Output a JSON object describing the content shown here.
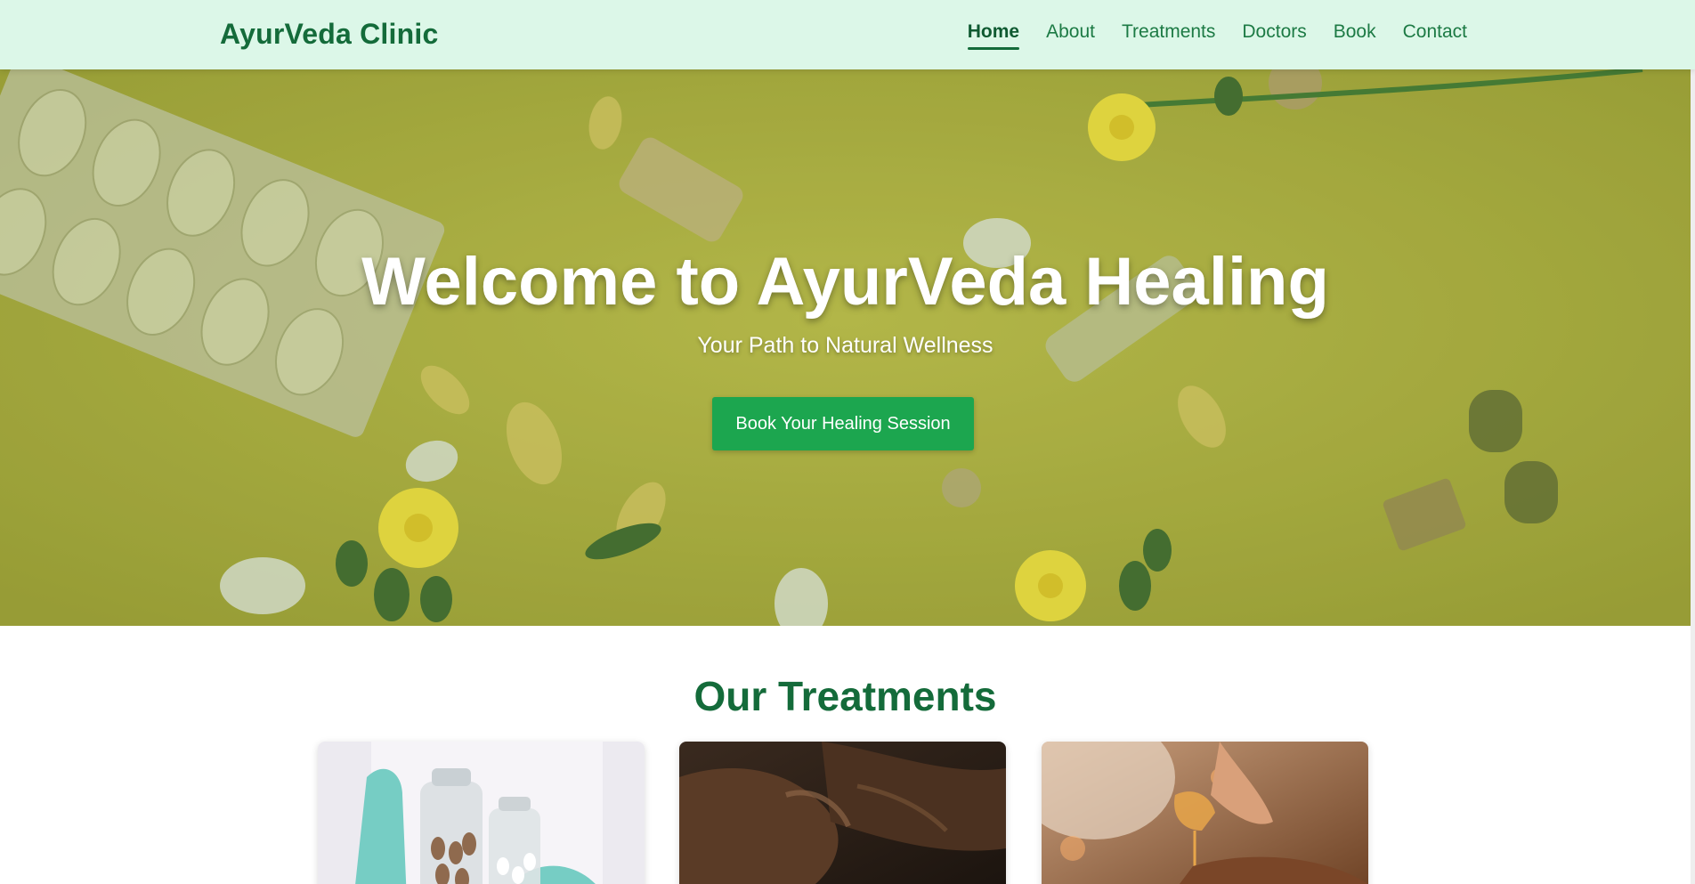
{
  "header": {
    "logo": "AyurVeda Clinic",
    "nav": [
      {
        "label": "Home",
        "active": true
      },
      {
        "label": "About",
        "active": false
      },
      {
        "label": "Treatments",
        "active": false
      },
      {
        "label": "Doctors",
        "active": false
      },
      {
        "label": "Book",
        "active": false
      },
      {
        "label": "Contact",
        "active": false
      }
    ]
  },
  "hero": {
    "title": "Welcome to AyurVeda Healing",
    "subtitle": "Your Path to Natural Wellness",
    "cta_label": "Book Your Healing Session"
  },
  "treatments": {
    "title": "Our Treatments",
    "cards": [
      {
        "image": "herbal-capsules-jars-photo"
      },
      {
        "image": "oil-massage-hands-photo"
      },
      {
        "image": "oil-pouring-massage-photo"
      }
    ]
  },
  "colors": {
    "header_bg": "#dcf7e8",
    "brand_green": "#146b3a",
    "cta_green": "#1ca64f",
    "hero_bg": "#b3b34a"
  }
}
